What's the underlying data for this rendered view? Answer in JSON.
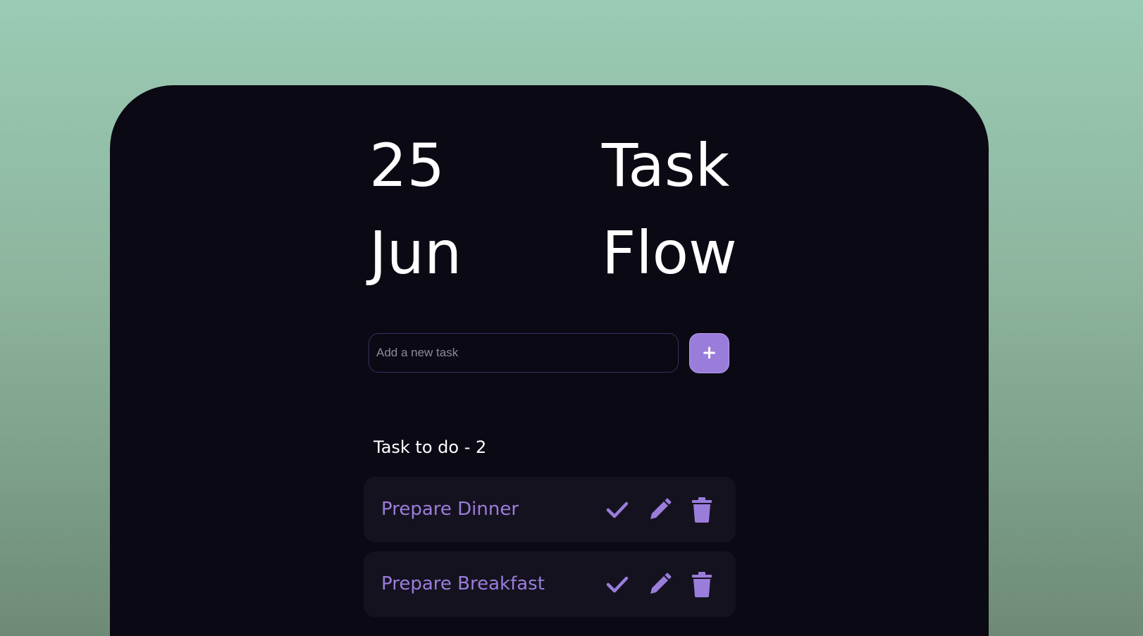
{
  "header": {
    "day": "25",
    "month": "Jun",
    "brand_line1": "Task",
    "brand_line2": "Flow"
  },
  "add_task": {
    "placeholder": "Add a new task",
    "value": "",
    "button_label": "+"
  },
  "task_list": {
    "heading": "Task to do - 2",
    "items": [
      {
        "text": "Prepare Dinner",
        "actions": [
          "check-icon",
          "pencil-icon",
          "trash-icon"
        ]
      },
      {
        "text": "Prepare Breakfast",
        "actions": [
          "check-icon",
          "pencil-icon",
          "trash-icon"
        ]
      }
    ]
  },
  "colors": {
    "background_top": "#9acbb4",
    "background_bottom": "#6e8a77",
    "card": "#0b0914",
    "accent": "#9a7ddb",
    "task_item": "#15121f",
    "text": "#ffffff"
  }
}
